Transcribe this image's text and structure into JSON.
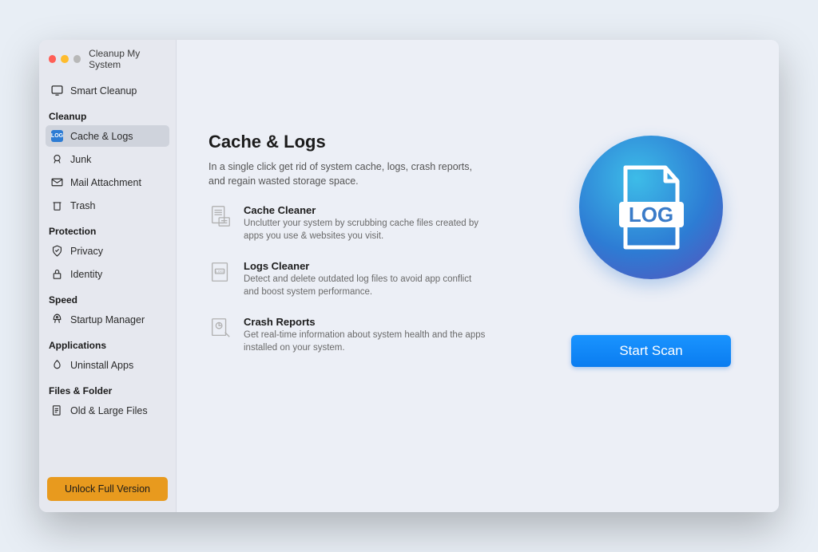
{
  "window": {
    "title": "Cleanup My System"
  },
  "sidebar": {
    "smart_cleanup": "Smart Cleanup",
    "sections": {
      "cleanup": "Cleanup",
      "protection": "Protection",
      "speed": "Speed",
      "applications": "Applications",
      "files_folder": "Files & Folder"
    },
    "items": {
      "cache_logs": "Cache & Logs",
      "junk": "Junk",
      "mail_attachment": "Mail Attachment",
      "trash": "Trash",
      "privacy": "Privacy",
      "identity": "Identity",
      "startup_manager": "Startup Manager",
      "uninstall_apps": "Uninstall Apps",
      "old_large_files": "Old & Large Files"
    },
    "unlock_btn": "Unlock Full Version"
  },
  "main": {
    "title": "Cache & Logs",
    "description": "In a single click get rid of system cache, logs, crash reports, and regain wasted storage space.",
    "features": [
      {
        "title": "Cache Cleaner",
        "desc": "Unclutter your system by scrubbing cache files created by apps you use & websites you visit."
      },
      {
        "title": "Logs Cleaner",
        "desc": "Detect and delete outdated log files to avoid app conflict and boost system performance."
      },
      {
        "title": "Crash Reports",
        "desc": "Get real-time information about system health and the apps installed on your system."
      }
    ],
    "start_scan": "Start Scan",
    "hero_label": "LOG"
  }
}
